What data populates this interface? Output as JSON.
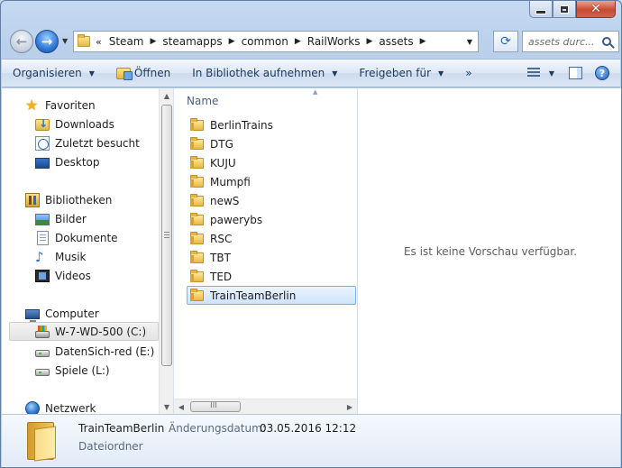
{
  "address": {
    "overflow": "«",
    "crumbs": [
      "Steam",
      "steamapps",
      "common",
      "RailWorks",
      "assets"
    ]
  },
  "search": {
    "placeholder": "assets durc..."
  },
  "toolbar": {
    "organize": "Organisieren",
    "open": "Öffnen",
    "include_library": "In Bibliothek aufnehmen",
    "share": "Freigeben für",
    "more": "»"
  },
  "nav": {
    "favorites": "Favoriten",
    "downloads": "Downloads",
    "recent": "Zuletzt besucht",
    "desktop": "Desktop",
    "libraries": "Bibliotheken",
    "pictures": "Bilder",
    "documents": "Dokumente",
    "music": "Musik",
    "videos": "Videos",
    "computer": "Computer",
    "drive_c": "W-7-WD-500 (C:)",
    "drive_e": "DatenSich-red (E:)",
    "drive_l": "Spiele (L:)",
    "network": "Netzwerk"
  },
  "files": {
    "column_name": "Name",
    "items": [
      "BerlinTrains",
      "DTG",
      "KUJU",
      "Mumpfi",
      "newS",
      "pawerybs",
      "RSC",
      "TBT",
      "TED",
      "TrainTeamBerlin"
    ]
  },
  "preview": {
    "message": "Es ist keine Vorschau verfügbar."
  },
  "details": {
    "name": "TrainTeamBerlin",
    "modified_label": "Änderungsdatum:",
    "modified_value": "03.05.2016 12:12",
    "type": "Dateiordner"
  },
  "scroll": {
    "h_grip": "III"
  }
}
